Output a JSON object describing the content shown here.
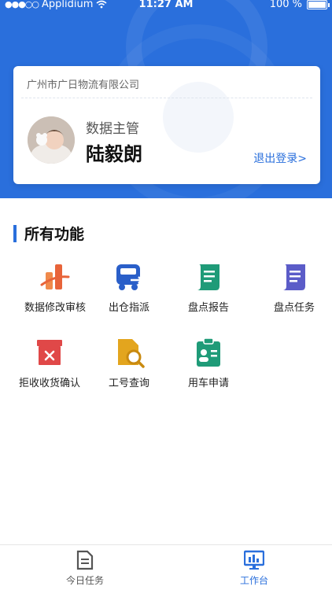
{
  "status_bar": {
    "carrier": "Applidium",
    "time": "11:27 AM",
    "battery": "100 %"
  },
  "profile_card": {
    "company": "广州市广日物流有限公司",
    "role": "数据主管",
    "name": "陆毅朗",
    "logout_label": "退出登录>"
  },
  "section": {
    "title": "所有功能"
  },
  "functions": [
    {
      "label": "数据修改审核",
      "icon": "data-audit-icon",
      "color": "#e8643a"
    },
    {
      "label": "出仓指派",
      "icon": "truck-dispatch-icon",
      "color": "#2a5fc9"
    },
    {
      "label": "盘点报告",
      "icon": "report-scroll-icon",
      "color": "#1f9b78"
    },
    {
      "label": "盘点任务",
      "icon": "task-scroll-icon",
      "color": "#5b5cc8"
    },
    {
      "label": "拒收收货确认",
      "icon": "reject-box-icon",
      "color": "#e04848"
    },
    {
      "label": "工号查询",
      "icon": "id-search-icon",
      "color": "#e3a51e"
    },
    {
      "label": "用车申请",
      "icon": "vehicle-request-icon",
      "color": "#1f9b78"
    }
  ],
  "bottom_nav": [
    {
      "label": "今日任务",
      "icon": "document-icon",
      "active": false
    },
    {
      "label": "工作台",
      "icon": "monitor-icon",
      "active": true
    }
  ],
  "colors": {
    "primary": "#2a6fdc",
    "inactive_nav": "#555555"
  }
}
